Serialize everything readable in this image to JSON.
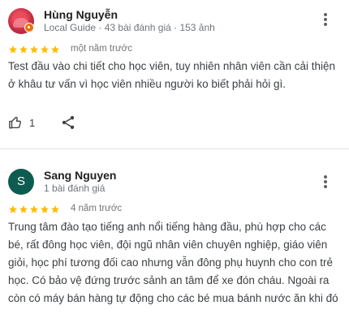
{
  "reviews": [
    {
      "author": "Hùng Nguyễn",
      "meta": "Local Guide · 43 bài đánh giá · 153 ảnh",
      "rating": 5,
      "time": "một năm trước",
      "text": "Test đầu vào chi tiết cho học viên, tuy nhiên nhân viên cần cải thiện ở khâu tư vấn vì học viên nhiều người ko biết phải hỏi gì.",
      "likes": "1",
      "avatar_color": "#c62f43",
      "badge_color": "#e8710a"
    },
    {
      "author": "Sang Nguyen",
      "meta": "1 bài đánh giá",
      "avatar_initial": "S",
      "avatar_color": "#0d5c4f",
      "rating": 5,
      "time": "4 năm trước",
      "text": "Trung tâm đào tạo tiếng anh nổi tiếng hàng đầu, phù hợp cho các bé, rất đông học viên, đội ngũ nhân viên chuyên nghiệp, giáo viên giỏi, học phí tương đối cao nhưng vẫn đông phụ huynh cho con trẻ học. Có bảo vệ đứng trước sảnh an tâm để xe đón cháu. Ngoài ra còn có máy bán hàng tự động cho các bé mua bánh nước ăn khi đó"
    }
  ],
  "icons": {
    "star": "star-icon",
    "more": "more-vert-icon",
    "like": "thumb-up-icon",
    "share": "share-icon"
  },
  "colors": {
    "star": "#fbbc04",
    "divider": "#dadce0",
    "secondary_text": "#70757a"
  }
}
